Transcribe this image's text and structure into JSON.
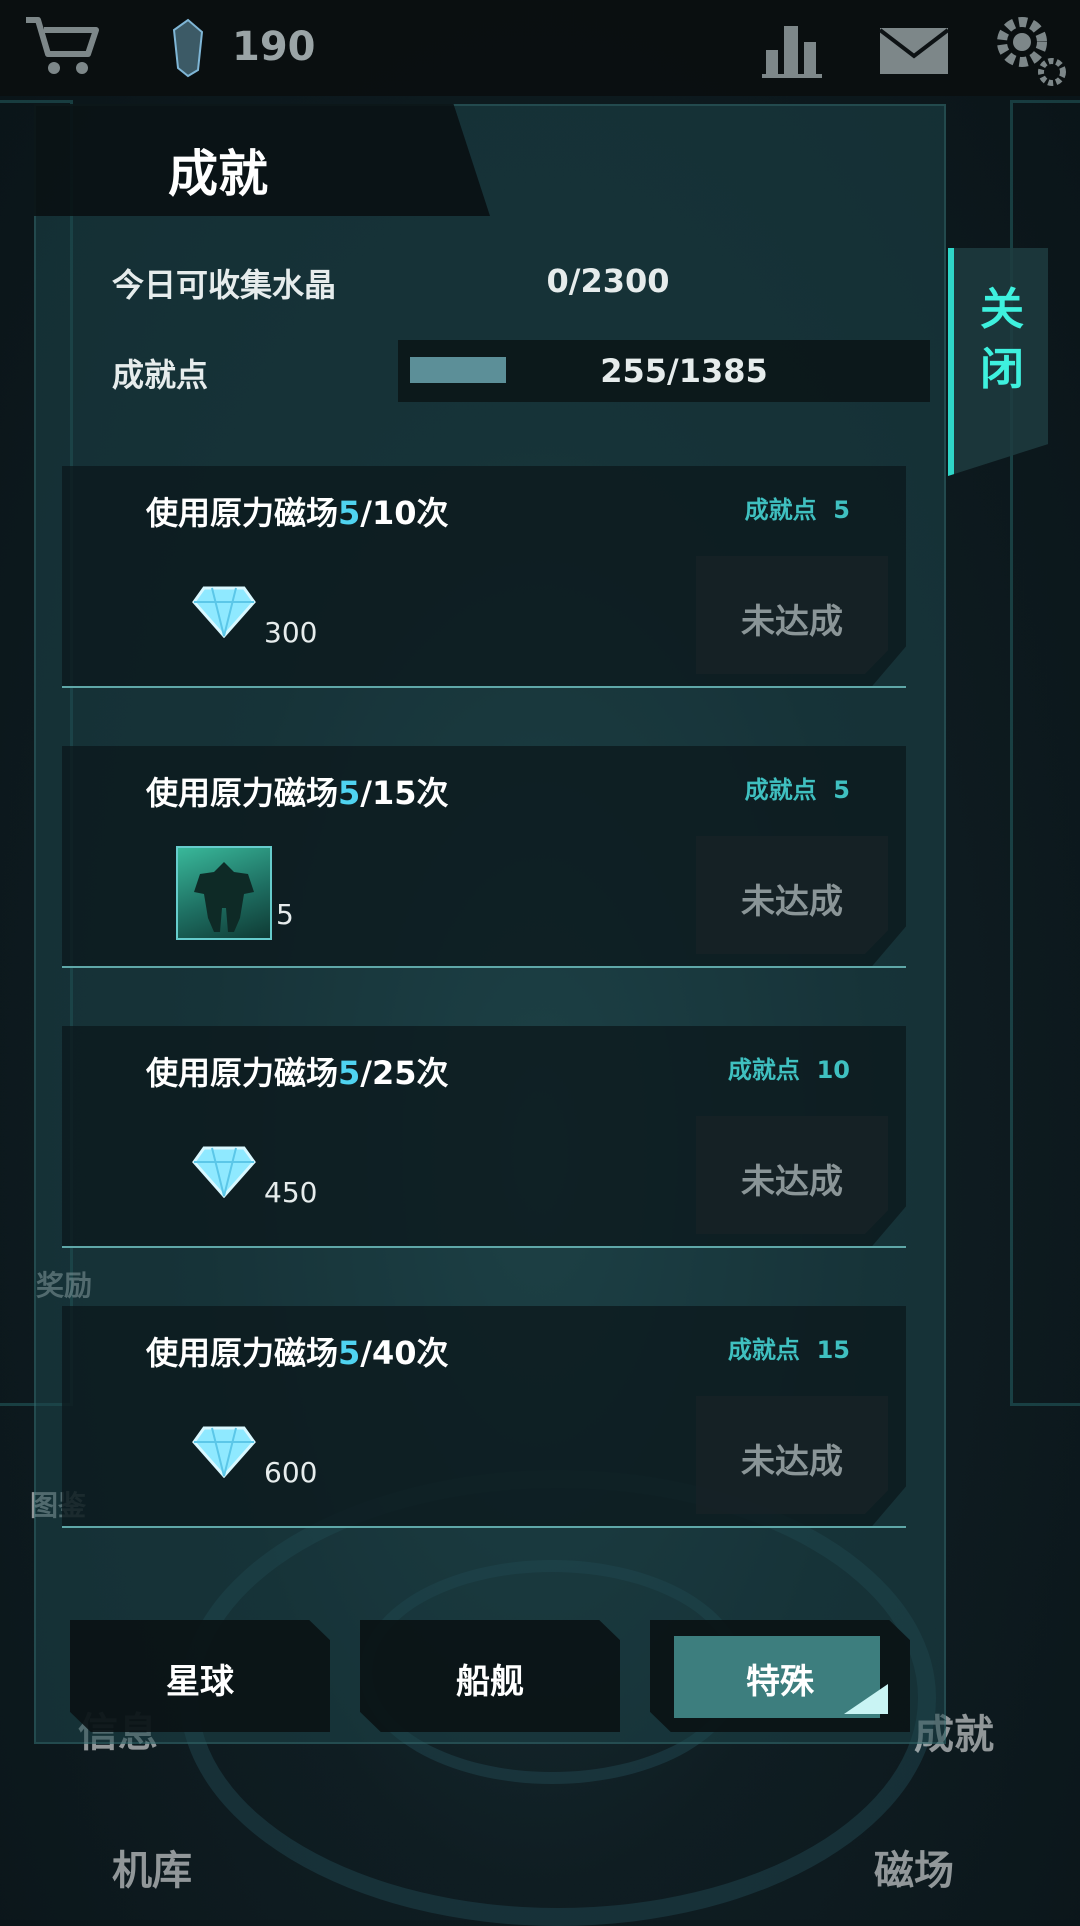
{
  "topbar": {
    "crystal_count": "190",
    "icons": [
      "shop-cart-icon",
      "crystal-icon",
      "leaderboard-icon",
      "mail-icon",
      "settings-gear-icon"
    ]
  },
  "panel": {
    "title": "成就",
    "daily_label": "今日可收集水晶",
    "daily_value": "0/2300",
    "points_label": "成就点",
    "points_value": "255/1385",
    "points_progress": 0.184
  },
  "close_label": "关闭",
  "achievements": [
    {
      "title_prefix": "使用原力磁场",
      "progress": "5",
      "title_suffix": "/10次",
      "points_label": "成就点",
      "points": "5",
      "reward_icon": "diamond-icon",
      "reward_amount": "300",
      "status": "未达成"
    },
    {
      "title_prefix": "使用原力磁场",
      "progress": "5",
      "title_suffix": "/15次",
      "points_label": "成就点",
      "points": "5",
      "reward_icon": "mech-card-icon",
      "reward_amount": "5",
      "status": "未达成"
    },
    {
      "title_prefix": "使用原力磁场",
      "progress": "5",
      "title_suffix": "/25次",
      "points_label": "成就点",
      "points": "10",
      "reward_icon": "diamond-icon",
      "reward_amount": "450",
      "status": "未达成"
    },
    {
      "title_prefix": "使用原力磁场",
      "progress": "5",
      "title_suffix": "/40次",
      "points_label": "成就点",
      "points": "15",
      "reward_icon": "diamond-icon",
      "reward_amount": "600",
      "status": "未达成"
    }
  ],
  "tabs": [
    {
      "label": "星球",
      "active": false
    },
    {
      "label": "船舰",
      "active": false
    },
    {
      "label": "特殊",
      "active": true
    }
  ],
  "background_labels": {
    "rewards": "奖励",
    "catalog": "图鉴",
    "info": "信息",
    "achievements": "成就",
    "hangar": "机库",
    "field": "磁场"
  },
  "colors": {
    "accent": "#3ef1de",
    "highlight": "#4fd3f0",
    "points": "#3fc0c0"
  }
}
